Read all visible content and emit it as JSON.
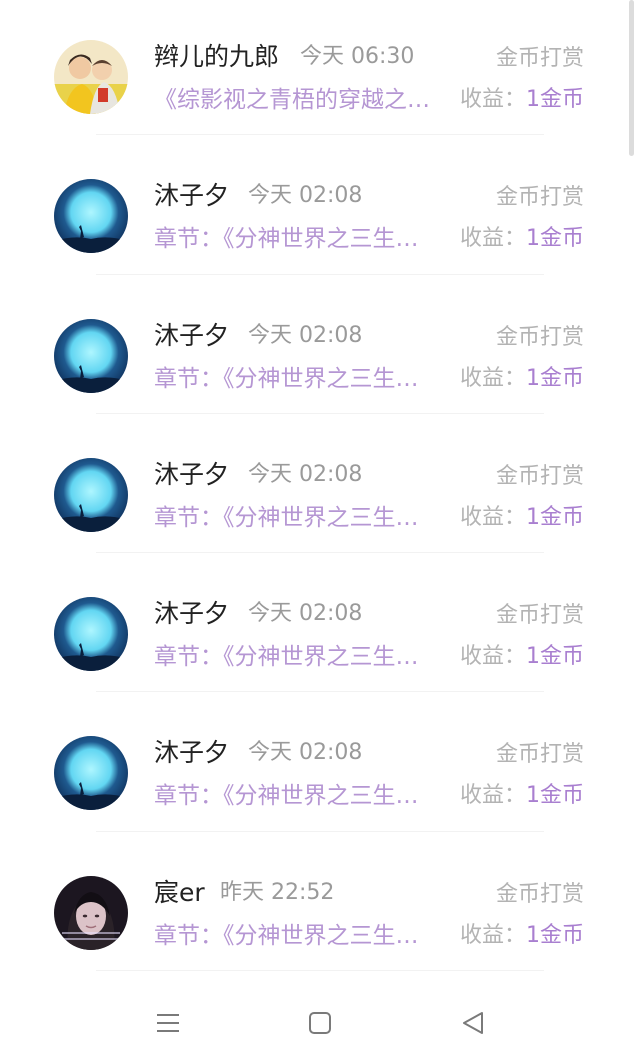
{
  "rows": [
    {
      "name": "辫儿的九郎",
      "time": "今天 06:30",
      "type": "金币打赏",
      "title": "《综影视之青梧的穿越之旅》",
      "income_label": "收益：",
      "income_value": "1金币",
      "avatar_icon": "cartoon-couple-avatar-icon"
    },
    {
      "name": "沐子夕",
      "time": "今天 02:08",
      "type": "金币打赏",
      "title": "章节：《分神世界之三生三世》",
      "income_label": "收益：",
      "income_value": "1金币",
      "avatar_icon": "moon-silhouette-avatar-icon"
    },
    {
      "name": "沐子夕",
      "time": "今天 02:08",
      "type": "金币打赏",
      "title": "章节：《分神世界之三生三世》",
      "income_label": "收益：",
      "income_value": "1金币",
      "avatar_icon": "moon-silhouette-avatar-icon"
    },
    {
      "name": "沐子夕",
      "time": "今天 02:08",
      "type": "金币打赏",
      "title": "章节：《分神世界之三生三世》",
      "income_label": "收益：",
      "income_value": "1金币",
      "avatar_icon": "moon-silhouette-avatar-icon"
    },
    {
      "name": "沐子夕",
      "time": "今天 02:08",
      "type": "金币打赏",
      "title": "章节：《分神世界之三生三世》",
      "income_label": "收益：",
      "income_value": "1金币",
      "avatar_icon": "moon-silhouette-avatar-icon"
    },
    {
      "name": "沐子夕",
      "time": "今天 02:08",
      "type": "金币打赏",
      "title": "章节：《分神世界之三生三世》",
      "income_label": "收益：",
      "income_value": "1金币",
      "avatar_icon": "moon-silhouette-avatar-icon"
    },
    {
      "name": "宸er",
      "time": "昨天 22:52",
      "type": "金币打赏",
      "title": "章节：《分神世界之三生三世》",
      "income_label": "收益：",
      "income_value": "1金币",
      "avatar_icon": "girl-photo-avatar-icon"
    }
  ],
  "nav": {
    "menu_icon": "menu-icon",
    "home_icon": "home-square-icon",
    "back_icon": "back-triangle-icon"
  },
  "colors": {
    "title": "#b596d3",
    "income_value": "#a97fd0",
    "muted": "#b3b3b3",
    "name": "#222222"
  }
}
